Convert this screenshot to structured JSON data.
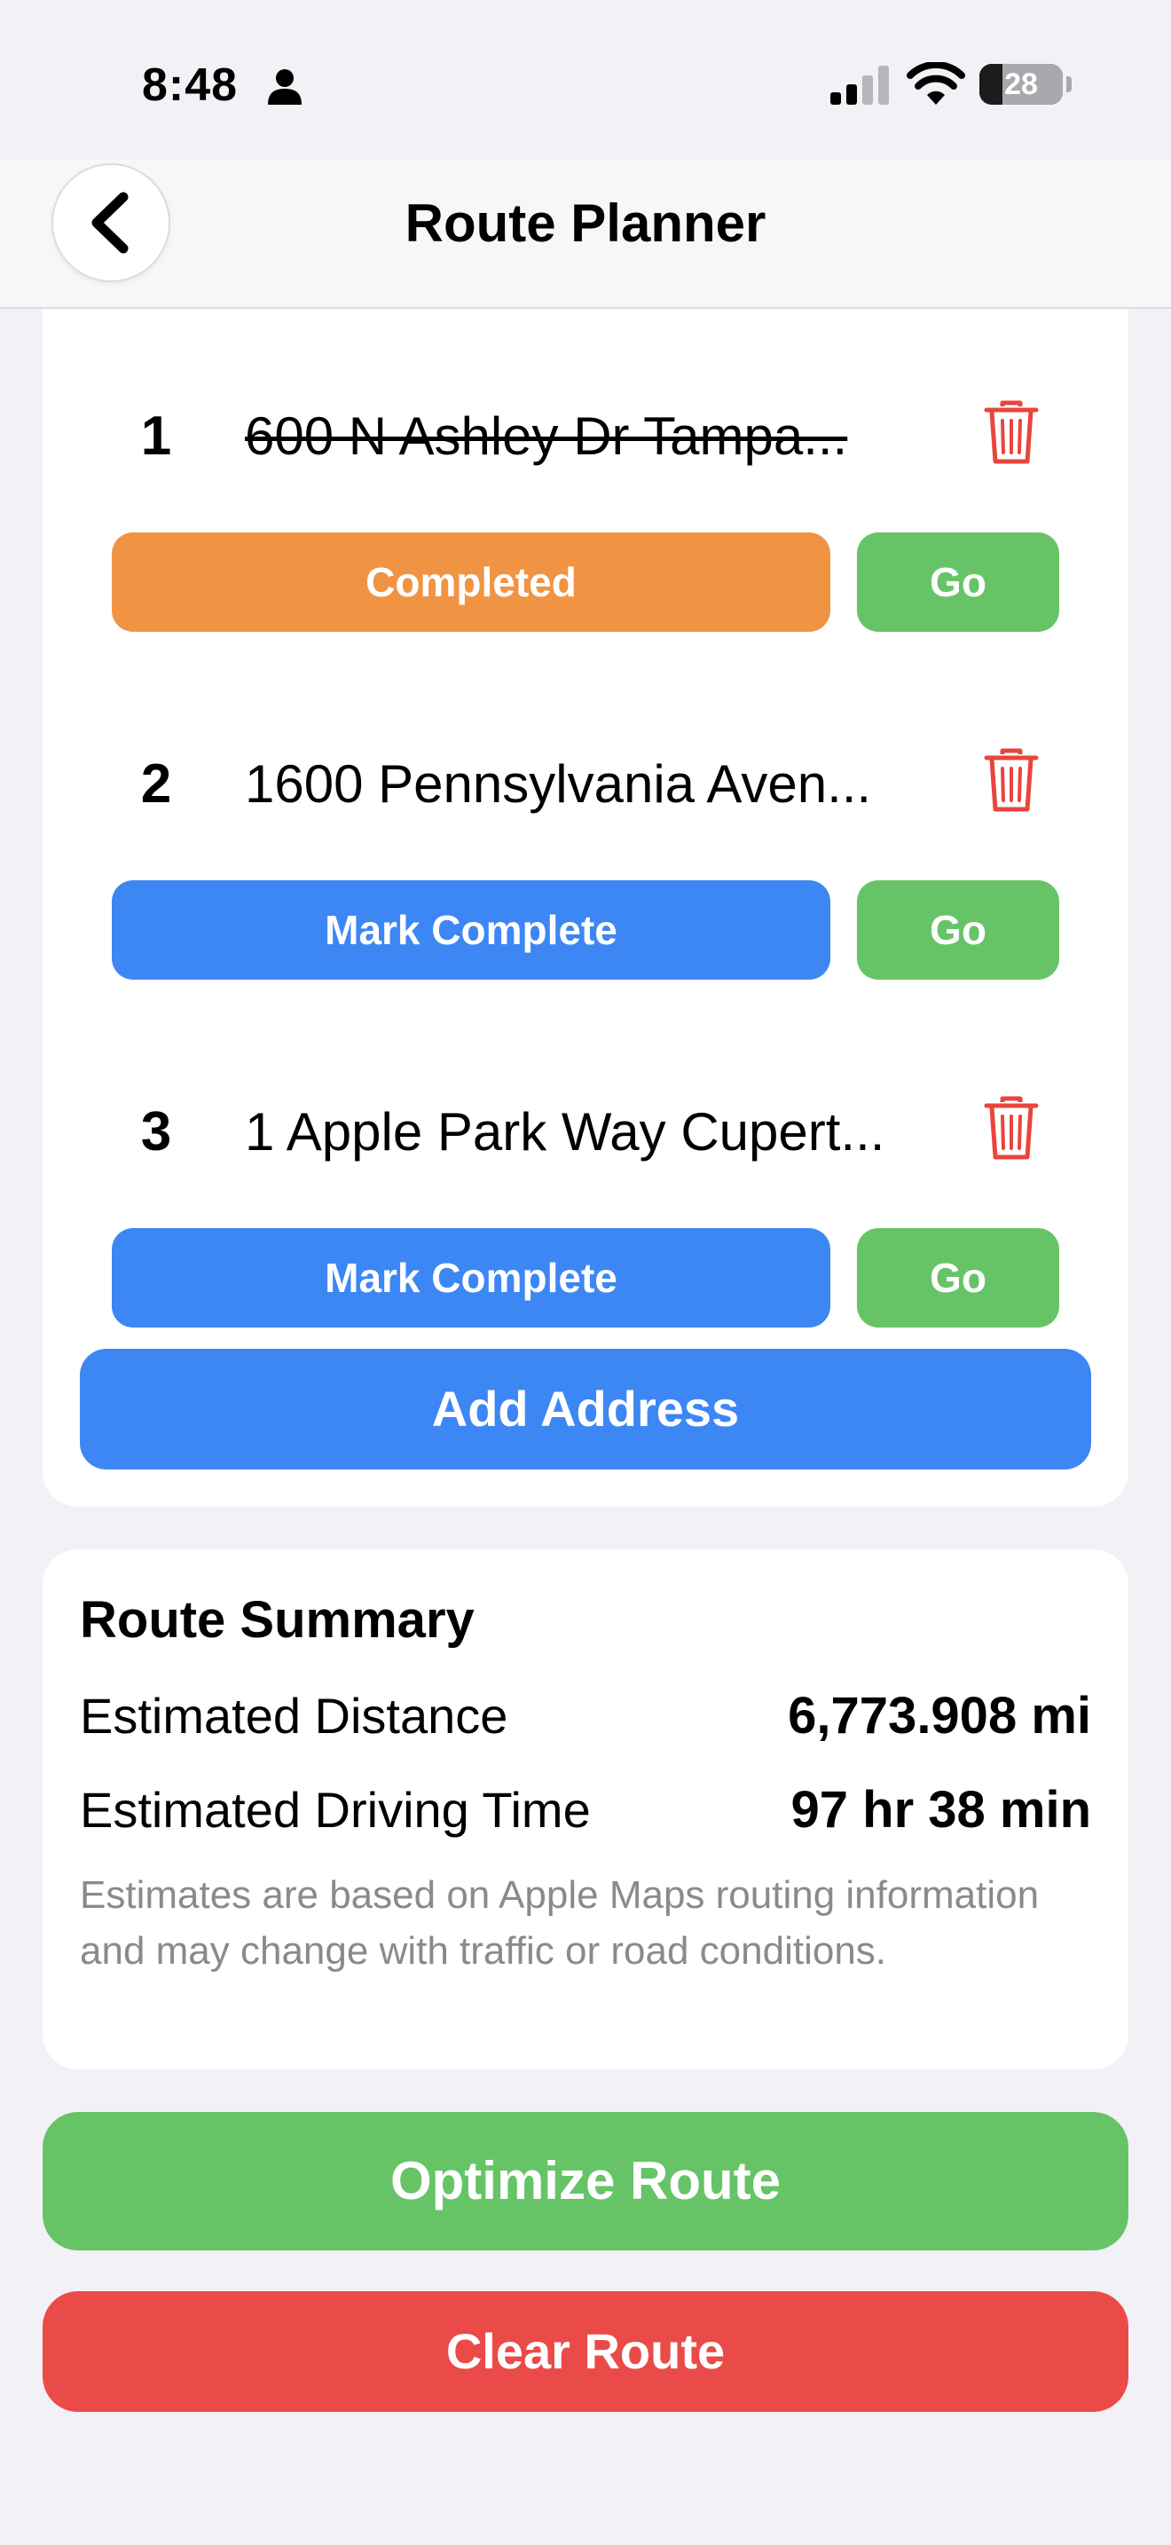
{
  "status_bar": {
    "time": "8:48",
    "battery_level": "28",
    "battery_fraction": 0.28
  },
  "nav": {
    "title": "Route Planner",
    "back_icon": "chevron-left-icon"
  },
  "stops": [
    {
      "number": "1",
      "address": "600 N Ashley Dr Tampa...",
      "completed": true,
      "status_label": "Completed",
      "go_label": "Go"
    },
    {
      "number": "2",
      "address": "1600 Pennsylvania Aven...",
      "completed": false,
      "status_label": "Mark Complete",
      "go_label": "Go"
    },
    {
      "number": "3",
      "address": "1 Apple Park Way Cupert...",
      "completed": false,
      "status_label": "Mark Complete",
      "go_label": "Go"
    }
  ],
  "add_address_label": "Add Address",
  "summary": {
    "title": "Route Summary",
    "distance_label": "Estimated Distance",
    "distance_value": "6,773.908 mi",
    "time_label": "Estimated Driving Time",
    "time_value": "97 hr 38 min",
    "note": "Estimates are based on Apple Maps routing information and may change with traffic or road conditions."
  },
  "actions": {
    "optimize_label": "Optimize Route",
    "clear_label": "Clear Route"
  },
  "colors": {
    "completed": "#f09444",
    "mark_complete": "#3d87f5",
    "go": "#66c466",
    "clear": "#eb4b48",
    "trash": "#e8453c"
  }
}
